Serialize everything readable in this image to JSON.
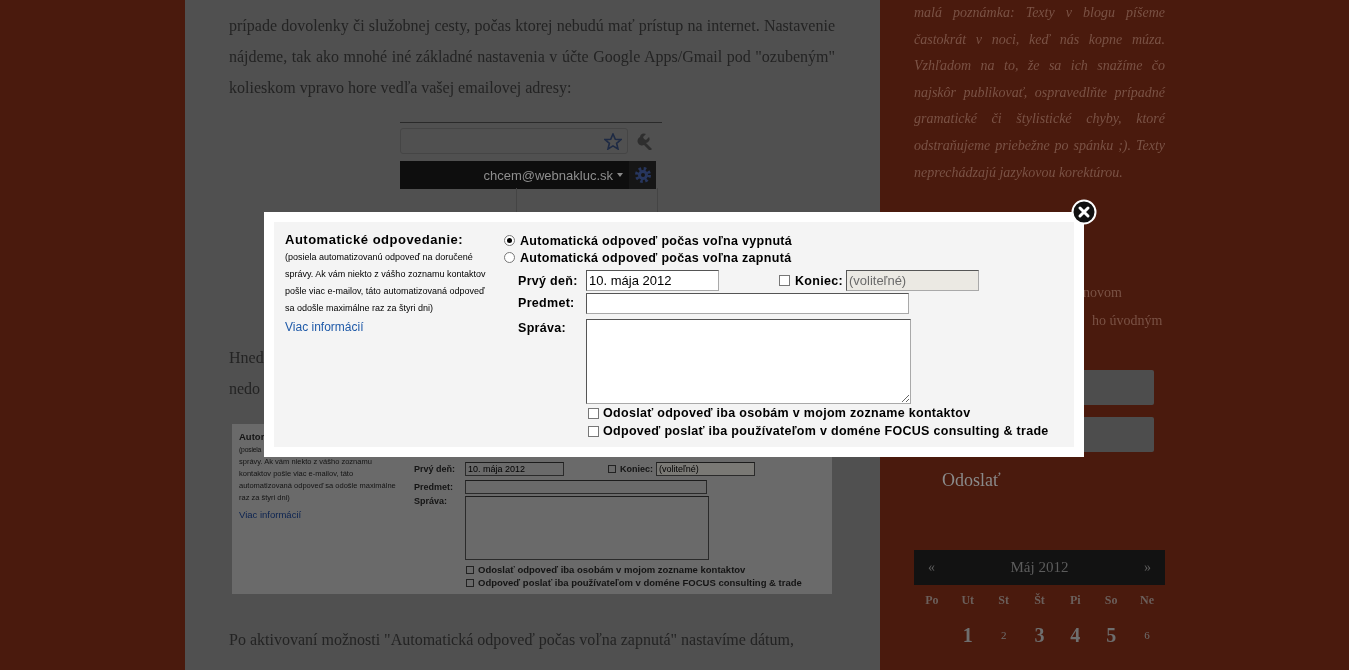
{
  "article": {
    "paragraph_1": "prípade dovolenky či služobnej cesty, počas ktorej nebudú mať prístup na internet. Nastavenie nájdeme, tak ako mnohé iné základné nastavenia v účte Google Apps/Gmail pod \"ozubeným\" kolieskom vpravo hore vedľa vašej emailovej adresy:",
    "screenshot_1": {
      "email": "chcem@webnakluc.sk"
    },
    "paragraph_2_fragments": [
      "Hned",
      "nedo"
    ],
    "screenshot_2": {
      "title": "Autor",
      "description_lines": [
        "(posiela",
        "správy. Ak vám niekto z vášho zoznamu",
        "kontaktov pošle viac e-mailov, táto",
        "automatizovaná odpoveď sa odošle maximálne",
        "raz za štyri dni)"
      ],
      "link": "Viac informácií",
      "first_day_label": "Prvý deň:",
      "first_day_value": "10. mája 2012",
      "end": {
        "label": "Koniec:",
        "checked": false,
        "placeholder": "(voliteľné)"
      },
      "subject_label": "Predmet:",
      "message_label": "Správa:",
      "options": [
        {
          "label": "Odoslať odpoveď iba osobám v mojom zozname kontaktov",
          "checked": false
        },
        {
          "label": "Odpoveď poslať iba používateľom v doméne FOCUS consulting & trade",
          "checked": false
        }
      ]
    },
    "paragraph_3": "Po aktivovaní možnosti \"Automatická odpoveď počas voľna zapnutá\" nastavíme dátum,"
  },
  "sidebar": {
    "note": "malá poznámka: Texty v blogu píšeme častokrát v noci, keď nás kopne múza. Vzhľadom na to, že sa ich snažíme čo najskôr publikovať, ospravedlňte prípadné gramatické či štylistické chyby, ktoré odstraňujeme priebežne po spánku ;). Texty neprechádzajú jazykovou korektúrou.",
    "fragments": [
      "novom",
      "ho úvodným"
    ],
    "submit_button": "Odoslať",
    "calendar": {
      "prev": "«",
      "month": "Máj 2012",
      "next": "»",
      "weekdays": [
        "Po",
        "Ut",
        "St",
        "Št",
        "Pi",
        "So",
        "Ne"
      ],
      "days": [
        {
          "day": "1",
          "has_posts": true
        },
        {
          "day": "2",
          "has_posts": false
        },
        {
          "day": "3",
          "has_posts": true
        },
        {
          "day": "4",
          "has_posts": true
        },
        {
          "day": "5",
          "has_posts": true
        },
        {
          "day": "6",
          "has_posts": false
        }
      ]
    }
  },
  "dialog": {
    "title": "Automatické odpovedanie:",
    "description": "(posiela automatizovanú odpoveď na doručené správy. Ak vám niekto z vášho zoznamu kontaktov pošle viac e-mailov, táto automatizovaná odpoveď sa odošle maximálne raz za štyri dni)",
    "link": "Viac informácií",
    "radios": [
      {
        "label": "Automatická odpoveď počas voľna vypnutá",
        "selected": true
      },
      {
        "label": "Automatická odpoveď počas voľna zapnutá",
        "selected": false
      }
    ],
    "first_day_label": "Prvý deň:",
    "first_day_value": "10. mája 2012",
    "end": {
      "label": "Koniec:",
      "checked": false,
      "placeholder": "(voliteľné)"
    },
    "subject_label": "Predmet:",
    "message_label": "Správa:",
    "options": [
      {
        "label": "Odoslať odpoveď iba osobám v mojom zozname kontaktov",
        "checked": false
      },
      {
        "label": "Odpoveď poslať iba používateľom v doméne FOCUS consulting & trade",
        "checked": false
      }
    ]
  }
}
